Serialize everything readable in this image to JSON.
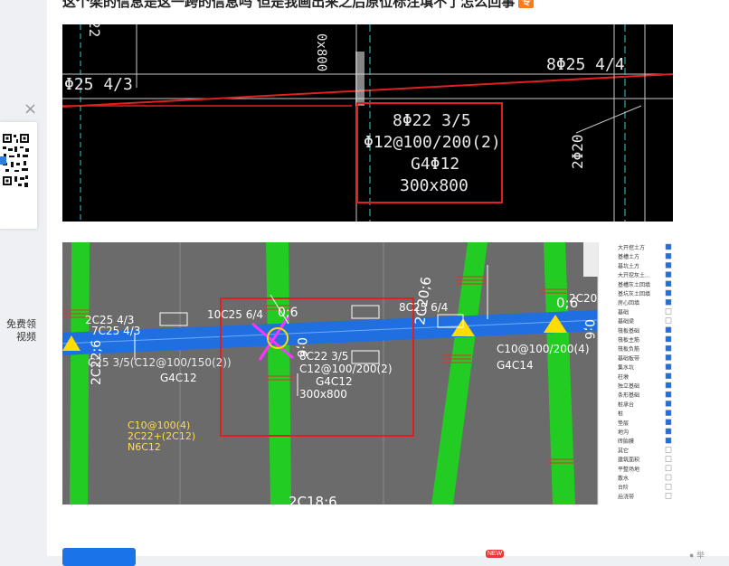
{
  "post": {
    "title": "这个梁的信息是这一跨的信息吗 但是我画出来之后原位标注填不了怎么回事",
    "badge": "专"
  },
  "promo": {
    "close_icon": "×",
    "line1": "免费领",
    "line2": "视频"
  },
  "cad_image": {
    "labels": {
      "top_left": "Φ25 4/3",
      "top_right": "8Φ25 4/4",
      "vert_left": "22",
      "vert_mid": "0x800",
      "right_vert": "2Φ20",
      "box_l1": "8Φ22 3/5",
      "box_l2": "Φ12@100/200(2)",
      "box_l3": "G4Φ12",
      "box_l4": "300x800"
    }
  },
  "software_image": {
    "labels": {
      "t1": "2C25 4/3",
      "t2": "7C25 4/3",
      "t3": "2C22;6",
      "t4": "C25 3/5(C12@100/150(2))",
      "t5": "G4C12",
      "t6": "10C25 6/4",
      "t7": "8C25 6/4",
      "t8": "8C22 3/5",
      "t9": "C12@100/200(2)",
      "t10": "G4C12",
      "t11": "300x800",
      "t12": "0;6",
      "t13": "0;6",
      "t14": "C10@100/200(4)",
      "t15": "G4C14",
      "t16": "2C20;6",
      "t17": "2C18;6",
      "t18": "C10@100(4)",
      "t19": "2C22+(2C12)",
      "t20": "N6C12",
      "t21": "0;6",
      "t22": "2C20;6"
    },
    "panel_items": [
      {
        "label": "大开挖土方",
        "checked": true
      },
      {
        "label": "基槽土方",
        "checked": true
      },
      {
        "label": "基坑土方",
        "checked": true
      },
      {
        "label": "大开挖灰土...",
        "checked": true
      },
      {
        "label": "基槽灰土回填",
        "checked": true
      },
      {
        "label": "基坑灰土回填",
        "checked": true
      },
      {
        "label": "房心回填",
        "checked": true
      },
      {
        "label": "基础",
        "checked": false
      },
      {
        "label": "基础梁",
        "checked": false
      },
      {
        "label": "筏板基础",
        "checked": true
      },
      {
        "label": "筏板主筋",
        "checked": true
      },
      {
        "label": "筏板负筋",
        "checked": true
      },
      {
        "label": "基础板带",
        "checked": true
      },
      {
        "label": "集水坑",
        "checked": true
      },
      {
        "label": "柱墩",
        "checked": true
      },
      {
        "label": "独立基础",
        "checked": true
      },
      {
        "label": "条形基础",
        "checked": true
      },
      {
        "label": "桩承台",
        "checked": true
      },
      {
        "label": "桩",
        "checked": true
      },
      {
        "label": "垫层",
        "checked": true
      },
      {
        "label": "地沟",
        "checked": true
      },
      {
        "label": "砖胎膜",
        "checked": true
      },
      {
        "label": "其它",
        "checked": false
      },
      {
        "label": "建筑面积",
        "checked": false
      },
      {
        "label": "平整场地",
        "checked": false
      },
      {
        "label": "散水",
        "checked": false
      },
      {
        "label": "台阶",
        "checked": false
      },
      {
        "label": "后浇带",
        "checked": false
      }
    ]
  },
  "footer": {
    "new_badge": "NEW",
    "hint": "● 举"
  }
}
